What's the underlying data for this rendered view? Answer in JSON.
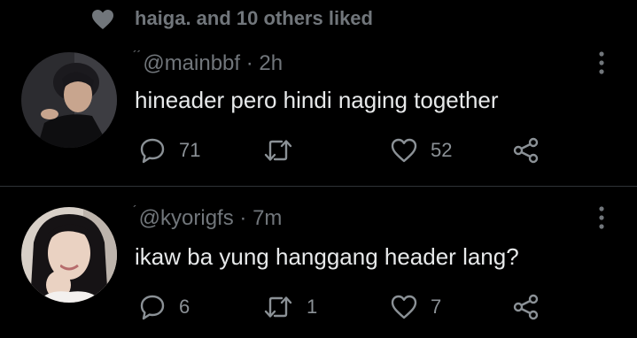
{
  "social_context": {
    "text": "haiga. and 10 others liked"
  },
  "tweets": [
    {
      "name_mark": "´´",
      "handle": "@mainbbf",
      "time": " · 2h",
      "text": "hineader pero hindi naging together",
      "reply_count": "71",
      "retweet_count": "",
      "like_count": "52"
    },
    {
      "name_mark": "´",
      "handle": "@kyorigfs",
      "time": " · 7m",
      "text": "ikaw ba yung hanggang header lang?",
      "reply_count": "6",
      "retweet_count": "1",
      "like_count": "7"
    }
  ],
  "colors": {
    "background": "#000000",
    "text": "#e7e9ea",
    "secondary": "#71767b",
    "divider": "#2f3336"
  },
  "icons": [
    "heart-icon",
    "reply-icon",
    "retweet-icon",
    "like-icon",
    "share-icon",
    "more-icon"
  ]
}
